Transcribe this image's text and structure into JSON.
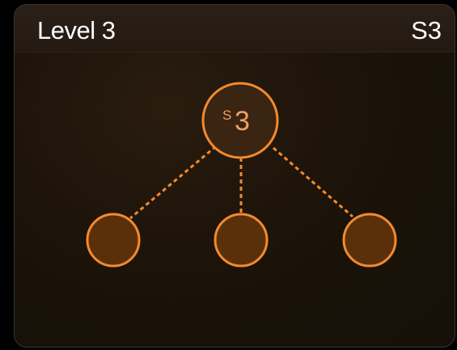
{
  "header": {
    "title": "Level 3",
    "code": "S3"
  },
  "tree": {
    "root": {
      "prefix": "S",
      "value": "3"
    },
    "children_count": 3
  },
  "colors": {
    "accent": "#f28a2e",
    "node_fill": "#5a300a",
    "root_fill": "#3a2412",
    "root_text": "#f0a060",
    "background": "#000000"
  }
}
